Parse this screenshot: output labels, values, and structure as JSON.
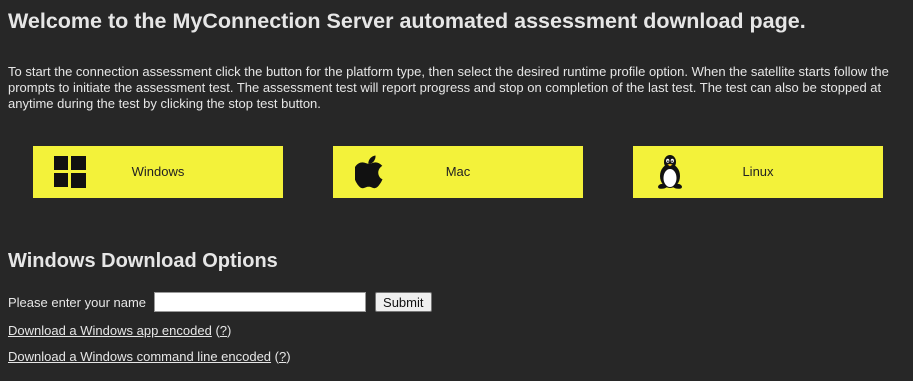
{
  "page": {
    "title": "Welcome to the MyConnection Server automated assessment download page.",
    "intro": "To start the connection assessment click the button for the platform type, then select the desired runtime profile option. When the satellite starts follow the prompts to initiate the assessment test. The assessment test will report progress and stop on completion of the last test. The test can also be stopped at anytime during the test by clicking the stop test button."
  },
  "platforms": {
    "windows": {
      "label": "Windows",
      "icon": "windows-logo-icon"
    },
    "mac": {
      "label": "Mac",
      "icon": "apple-logo-icon"
    },
    "linux": {
      "label": "Linux",
      "icon": "tux-penguin-icon"
    }
  },
  "download_options": {
    "heading": "Windows Download Options",
    "name_label": "Please enter your name",
    "name_value": "",
    "submit_label": "Submit",
    "links": [
      {
        "label": "Download a Windows app encoded",
        "help": "?"
      },
      {
        "label": "Download a Windows command line encoded",
        "help": "?"
      }
    ]
  },
  "colors": {
    "background": "#272727",
    "button_bg": "#f3f23a",
    "text": "#e6e6e6"
  }
}
